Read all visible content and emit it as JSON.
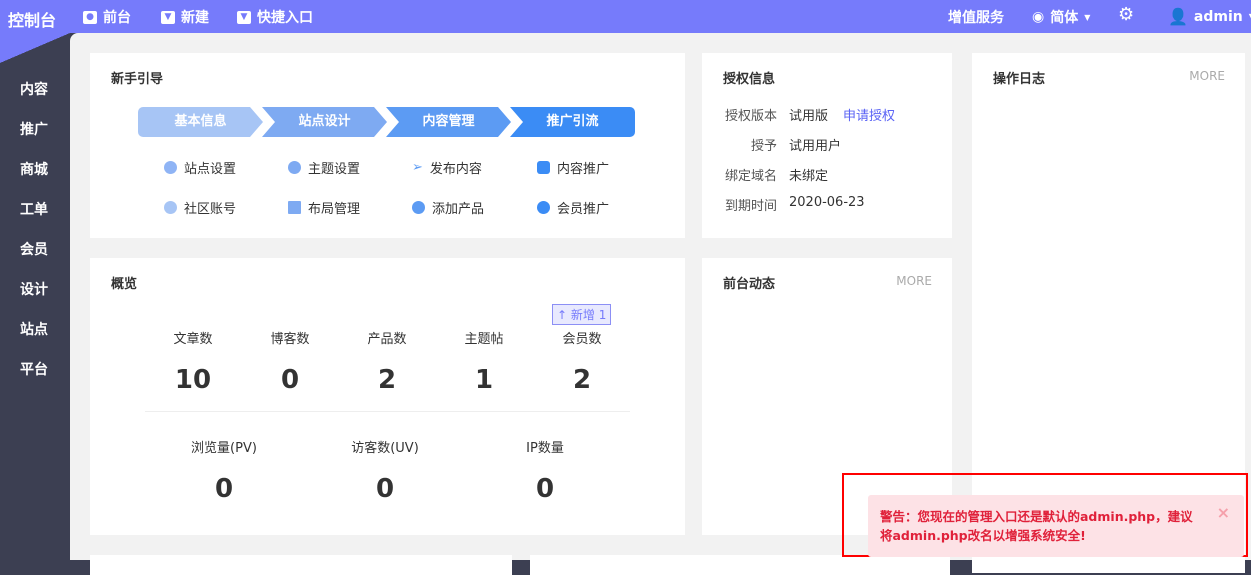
{
  "topbar": {
    "logo": "控制台",
    "nav": [
      {
        "label": "前台",
        "icon": "eye-icon"
      },
      {
        "label": "新建",
        "icon": "caret-down-icon"
      },
      {
        "label": "快捷入口",
        "icon": "caret-down-icon"
      }
    ],
    "value_service": "增值服务",
    "language": "简体",
    "user": "admin"
  },
  "sidebar": {
    "items": [
      "内容",
      "推广",
      "商城",
      "工单",
      "会员",
      "设计",
      "站点",
      "平台"
    ]
  },
  "guide": {
    "title": "新手引导",
    "steps": [
      "基本信息",
      "站点设计",
      "内容管理",
      "推广引流"
    ],
    "step_colors": [
      "#a7c5f5",
      "#7eaaf2",
      "#5c9bf3",
      "#3b8cf5"
    ],
    "items": [
      "站点设置",
      "主题设置",
      "发布内容",
      "内容推广",
      "社区账号",
      "布局管理",
      "添加产品",
      "会员推广"
    ]
  },
  "license": {
    "title": "授权信息",
    "rows": [
      {
        "label": "授权版本",
        "value": "试用版",
        "link": "申请授权"
      },
      {
        "label": "授予",
        "value": "试用用户"
      },
      {
        "label": "绑定域名",
        "value": "未绑定"
      },
      {
        "label": "到期时间",
        "value": "2020-06-23"
      }
    ]
  },
  "oplog": {
    "title": "操作日志",
    "more": "MORE"
  },
  "overview": {
    "title": "概览",
    "badge": "新增 1",
    "stats1": [
      {
        "label": "文章数",
        "value": "10"
      },
      {
        "label": "博客数",
        "value": "0"
      },
      {
        "label": "产品数",
        "value": "2"
      },
      {
        "label": "主题帖",
        "value": "1"
      },
      {
        "label": "会员数",
        "value": "2"
      }
    ],
    "stats2": [
      {
        "label": "浏览量(PV)",
        "value": "0"
      },
      {
        "label": "访客数(UV)",
        "value": "0"
      },
      {
        "label": "IP数量",
        "value": "0"
      }
    ]
  },
  "front": {
    "title": "前台动态",
    "more": "MORE"
  },
  "warning": {
    "text": "警告：您现在的管理入口还是默认的admin.php，建议将admin.php改名以增强系统安全!"
  }
}
